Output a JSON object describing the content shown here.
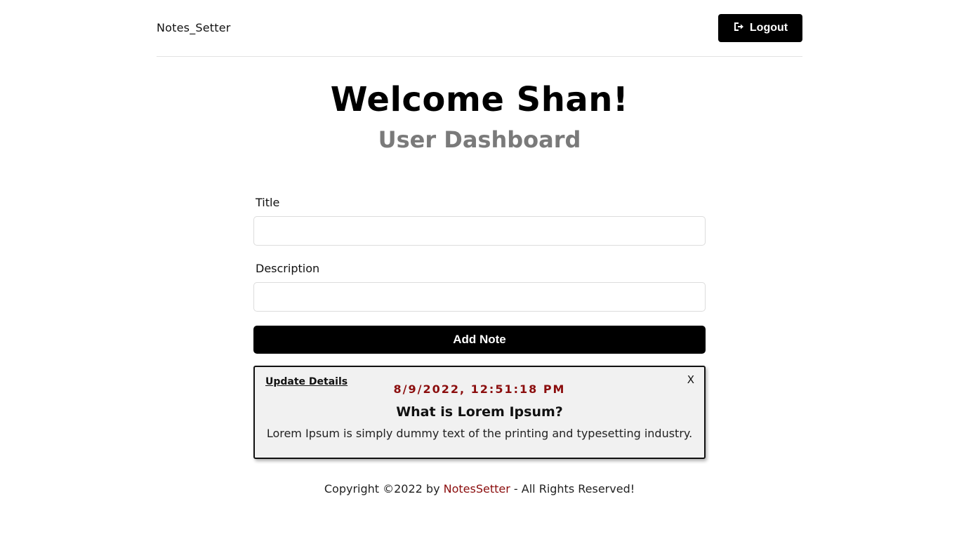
{
  "navbar": {
    "brand": "Notes_Setter",
    "logout_label": "Logout",
    "logout_icon": "sign-out-icon"
  },
  "header": {
    "welcome": "Welcome Shan!",
    "subtitle": "User Dashboard"
  },
  "form": {
    "title_label": "Title",
    "title_value": "",
    "description_label": "Description",
    "description_value": "",
    "add_button_label": "Add Note"
  },
  "notes": [
    {
      "update_link": "Update Details",
      "close_label": "X",
      "date": "8/9/2022, 12:51:18 PM",
      "title": "What is Lorem Ipsum?",
      "description": "Lorem Ipsum is simply dummy text of the printing and typesetting industry."
    }
  ],
  "footer": {
    "prefix": "Copyright ©2022 by ",
    "link": "NotesSetter",
    "suffix": " - All Rights Reserved!"
  },
  "colors": {
    "accent": "#8b0d0d",
    "button": "#000000",
    "subtitle": "#7a7a7a",
    "card_bg": "#f1f1f1"
  }
}
